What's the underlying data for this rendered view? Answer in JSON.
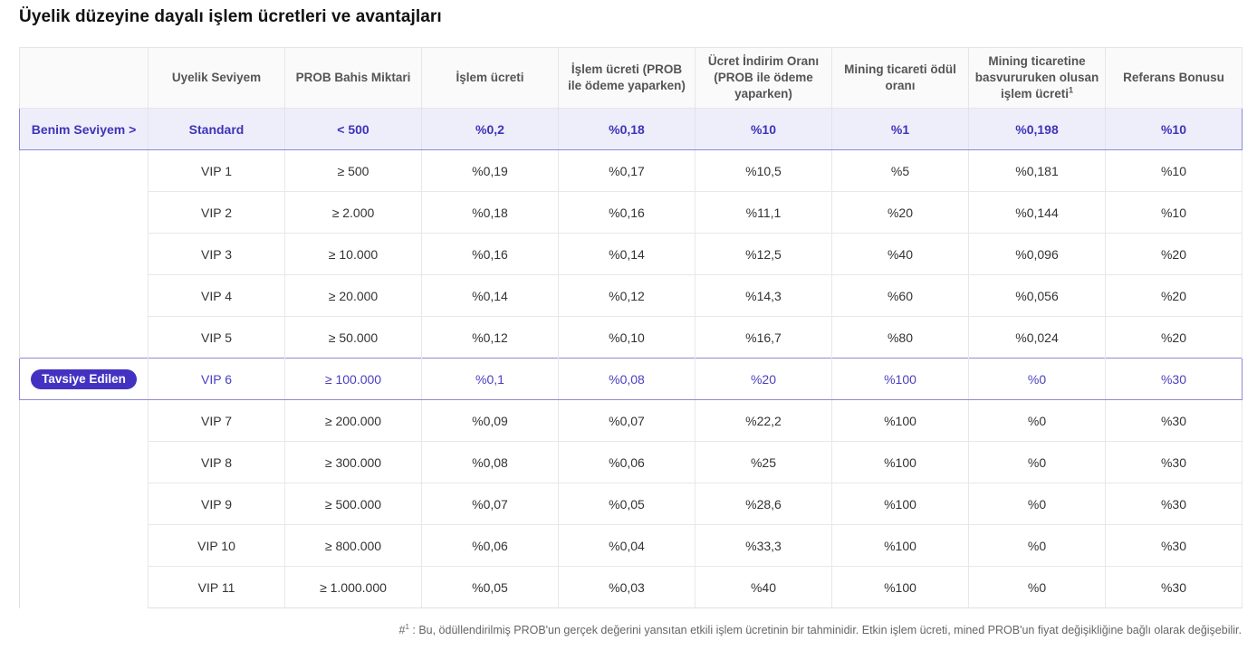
{
  "title": "Üyelik düzeyine dayalı işlem ücretleri ve avantajları",
  "table": {
    "headers": [
      "",
      "Uyelik Seviyem",
      "PROB Bahis Miktari",
      "İşlem ücreti",
      "İşlem ücreti (PROB ile ödeme yaparken)",
      "Ücret İndirim Oranı (PROB ile ödeme yaparken)",
      "Mining ticareti ödül oranı",
      "Mining ticaretine basvururuken olusan işlem ücreti",
      "Referans Bonusu"
    ],
    "header_footnote_mark": "1",
    "current_label": "Benim Seviyem >",
    "recommended_label": "Tavsiye Edilen",
    "rows": [
      [
        "Standard",
        "< 500",
        "%0,2",
        "%0,18",
        "%10",
        "%1",
        "%0,198",
        "%10"
      ],
      [
        "VIP 1",
        "≥ 500",
        "%0,19",
        "%0,17",
        "%10,5",
        "%5",
        "%0,181",
        "%10"
      ],
      [
        "VIP 2",
        "≥ 2.000",
        "%0,18",
        "%0,16",
        "%11,1",
        "%20",
        "%0,144",
        "%10"
      ],
      [
        "VIP 3",
        "≥ 10.000",
        "%0,16",
        "%0,14",
        "%12,5",
        "%40",
        "%0,096",
        "%20"
      ],
      [
        "VIP 4",
        "≥ 20.000",
        "%0,14",
        "%0,12",
        "%14,3",
        "%60",
        "%0,056",
        "%20"
      ],
      [
        "VIP 5",
        "≥ 50.000",
        "%0,12",
        "%0,10",
        "%16,7",
        "%80",
        "%0,024",
        "%20"
      ],
      [
        "VIP 6",
        "≥ 100.000",
        "%0,1",
        "%0,08",
        "%20",
        "%100",
        "%0",
        "%30"
      ],
      [
        "VIP 7",
        "≥ 200.000",
        "%0,09",
        "%0,07",
        "%22,2",
        "%100",
        "%0",
        "%30"
      ],
      [
        "VIP 8",
        "≥ 300.000",
        "%0,08",
        "%0,06",
        "%25",
        "%100",
        "%0",
        "%30"
      ],
      [
        "VIP 9",
        "≥ 500.000",
        "%0,07",
        "%0,05",
        "%28,6",
        "%100",
        "%0",
        "%30"
      ],
      [
        "VIP 10",
        "≥ 800.000",
        "%0,06",
        "%0,04",
        "%33,3",
        "%100",
        "%0",
        "%30"
      ],
      [
        "VIP 11",
        "≥ 1.000.000",
        "%0,05",
        "%0,03",
        "%40",
        "%100",
        "%0",
        "%30"
      ]
    ]
  },
  "footnote": {
    "prefix": "#",
    "mark": "1",
    "text": " : Bu, ödüllendirilmiş PROB'un gerçek değerini yansıtan etkili işlem ücretinin bir tahminidir. Etkin işlem ücreti, mined PROB'un fiyat değişikliğine bağlı olarak değişebilir."
  },
  "colors": {
    "accent": "#4332c2",
    "current_row_bg": "#eeeefb",
    "highlight_border": "#8f88d9"
  }
}
